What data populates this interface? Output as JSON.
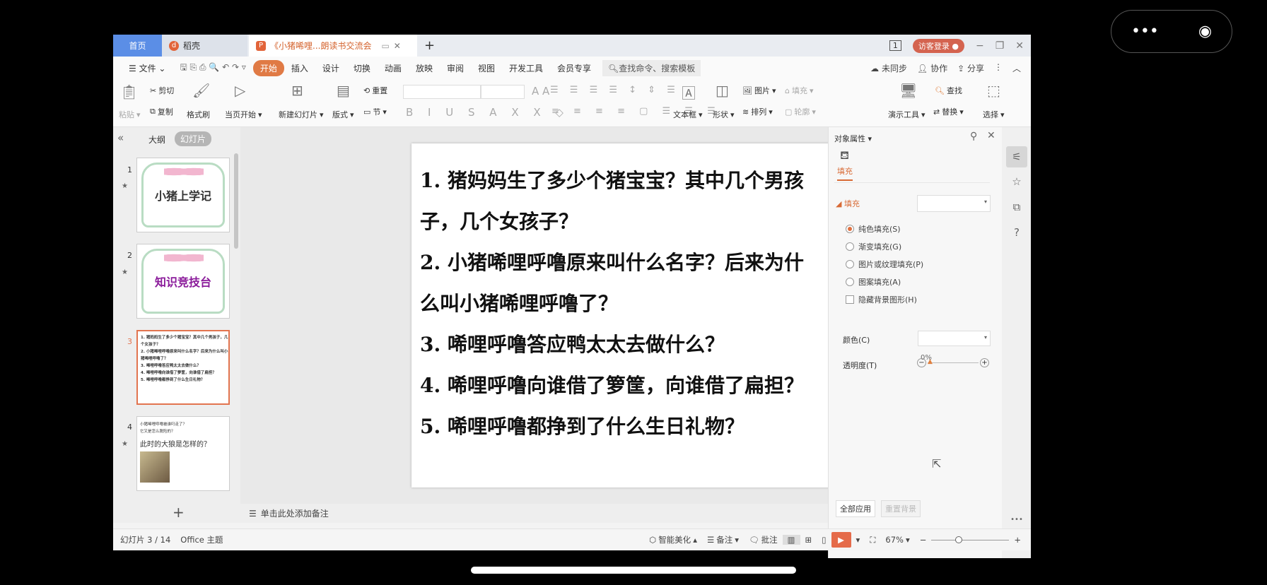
{
  "tabs": {
    "home": "首页",
    "docer": "稻壳",
    "doc": "《小猪唏哩...朗读书交流会",
    "new_tab": "+"
  },
  "window": {
    "page_badge": "1",
    "login": "访客登录"
  },
  "menu": {
    "file": "文件",
    "items": [
      "开始",
      "插入",
      "设计",
      "切换",
      "动画",
      "放映",
      "审阅",
      "视图",
      "开发工具",
      "会员专享"
    ],
    "active": "开始",
    "search": "查找命令、搜索模板",
    "sync": "未同步",
    "collab": "协作",
    "share": "分享"
  },
  "ribbon": {
    "paste": "粘贴",
    "cut": "剪切",
    "copy": "复制",
    "format_painter": "格式刷",
    "play_current": "当页开始",
    "new_slide": "新建幻灯片",
    "layout": "版式",
    "section": "节",
    "reset": "重置",
    "textbox": "文本框",
    "shape": "形状",
    "picture": "图片",
    "fill": "填充",
    "arrange": "排列",
    "outline": "轮廓",
    "presenter_tools": "演示工具",
    "find": "查找",
    "replace": "替换",
    "select": "选择"
  },
  "left_panel": {
    "outline_tab": "大纲",
    "slides_tab": "幻灯片",
    "add": "+",
    "slides": [
      {
        "num": "1",
        "title": "小猪上学记"
      },
      {
        "num": "2",
        "title": "知识竞技台"
      },
      {
        "num": "3",
        "lines": [
          "1. 猪妈妈生了多少个猪宝宝？其中几个男孩子，几个女孩子？",
          "2. 小猪唏哩呼噜原来叫什么名字？后来为什么叫小猪唏哩呼噜了？",
          "3. 唏哩呼噜答应鸭太太去做什么？",
          "4. 唏哩呼噜向谁借了箩筐，向谁借了扁担？",
          "5. 唏哩呼噜都挣到了什么生日礼物？"
        ]
      },
      {
        "num": "4",
        "lines": [
          "小猪唏哩呼噜被谁叼走了？",
          "它又是怎么脱险的？"
        ],
        "title": "此时的大狼是怎样的？"
      }
    ]
  },
  "slide": {
    "lines": [
      "1. 猪妈妈生了多少个猪宝宝？其中几个男孩",
      "子，几个女孩子？",
      "2. 小猪唏哩呼噜原来叫什么名字？后来为什",
      "么叫小猪唏哩呼噜了？",
      "3. 唏哩呼噜答应鸭太太去做什么？",
      "4. 唏哩呼噜向谁借了箩筐，向谁借了扁担？",
      "5. 唏哩呼噜都挣到了什么生日礼物？"
    ]
  },
  "notes": {
    "placeholder": "单击此处添加备注"
  },
  "right_panel": {
    "title": "对象属性",
    "fill_tab": "填充",
    "fill_section": "填充",
    "options": [
      "纯色填充(S)",
      "渐变填充(G)",
      "图片或纹理填充(P)",
      "图案填充(A)"
    ],
    "selected": "纯色填充(S)",
    "hide_bg": "隐藏背景图形(H)",
    "color_label": "颜色(C)",
    "transparency_label": "透明度(T)",
    "transparency": "0%",
    "apply_all": "全部应用",
    "reset_bg": "重置背景"
  },
  "status": {
    "slide_info": "幻灯片 3 / 14",
    "theme": "Office 主题",
    "beautify": "智能美化",
    "notes": "备注",
    "comments": "批注",
    "zoom": "67%"
  },
  "colors": {
    "accent": "#e07a45",
    "home_tab": "#5b8ee6",
    "selection": "#e2744f"
  }
}
